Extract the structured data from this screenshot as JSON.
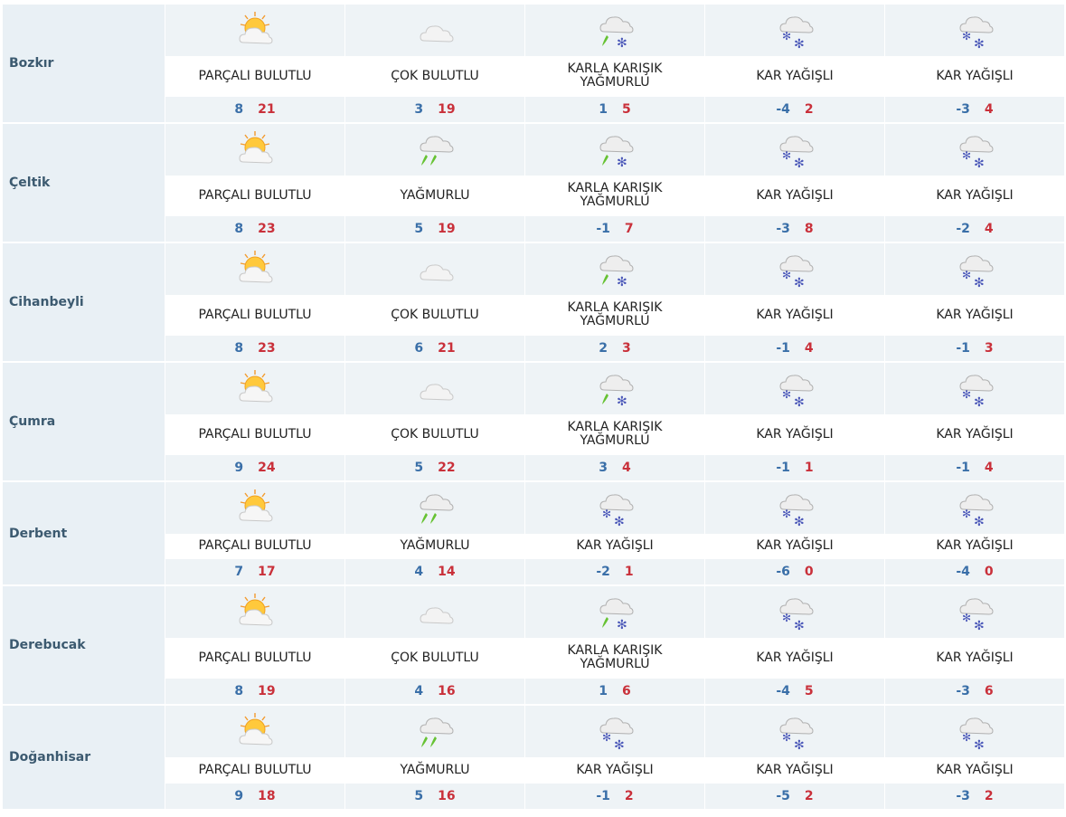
{
  "colors": {
    "min_temp": "#3a6fa8",
    "max_temp": "#c9303a",
    "city": "#3c5a70",
    "band": "#eef3f6"
  },
  "rows": [
    {
      "city": "Bozkır",
      "days": [
        {
          "icon": "partly-cloudy-icon",
          "cond": "PARÇALI BULUTLU",
          "min": "8",
          "max": "21"
        },
        {
          "icon": "cloudy-icon",
          "cond": "ÇOK BULUTLU",
          "min": "3",
          "max": "19"
        },
        {
          "icon": "sleet-icon",
          "cond": "KARLA KARIŞIK YAĞMURLU",
          "min": "1",
          "max": "5"
        },
        {
          "icon": "snow-icon",
          "cond": "KAR YAĞIŞLI",
          "min": "-4",
          "max": "2"
        },
        {
          "icon": "snow-icon",
          "cond": "KAR YAĞIŞLI",
          "min": "-3",
          "max": "4"
        }
      ]
    },
    {
      "city": "Çeltik",
      "days": [
        {
          "icon": "partly-cloudy-icon",
          "cond": "PARÇALI BULUTLU",
          "min": "8",
          "max": "23"
        },
        {
          "icon": "rain-icon",
          "cond": "YAĞMURLU",
          "min": "5",
          "max": "19"
        },
        {
          "icon": "sleet-icon",
          "cond": "KARLA KARIŞIK YAĞMURLU",
          "min": "-1",
          "max": "7"
        },
        {
          "icon": "snow-icon",
          "cond": "KAR YAĞIŞLI",
          "min": "-3",
          "max": "8"
        },
        {
          "icon": "snow-icon",
          "cond": "KAR YAĞIŞLI",
          "min": "-2",
          "max": "4"
        }
      ]
    },
    {
      "city": "Cihanbeyli",
      "days": [
        {
          "icon": "partly-cloudy-icon",
          "cond": "PARÇALI BULUTLU",
          "min": "8",
          "max": "23"
        },
        {
          "icon": "cloudy-icon",
          "cond": "ÇOK BULUTLU",
          "min": "6",
          "max": "21"
        },
        {
          "icon": "sleet-icon",
          "cond": "KARLA KARIŞIK YAĞMURLU",
          "min": "2",
          "max": "3"
        },
        {
          "icon": "snow-icon",
          "cond": "KAR YAĞIŞLI",
          "min": "-1",
          "max": "4"
        },
        {
          "icon": "snow-icon",
          "cond": "KAR YAĞIŞLI",
          "min": "-1",
          "max": "3"
        }
      ]
    },
    {
      "city": "Çumra",
      "days": [
        {
          "icon": "partly-cloudy-icon",
          "cond": "PARÇALI BULUTLU",
          "min": "9",
          "max": "24"
        },
        {
          "icon": "cloudy-icon",
          "cond": "ÇOK BULUTLU",
          "min": "5",
          "max": "22"
        },
        {
          "icon": "sleet-icon",
          "cond": "KARLA KARIŞIK YAĞMURLU",
          "min": "3",
          "max": "4"
        },
        {
          "icon": "snow-icon",
          "cond": "KAR YAĞIŞLI",
          "min": "-1",
          "max": "1"
        },
        {
          "icon": "snow-icon",
          "cond": "KAR YAĞIŞLI",
          "min": "-1",
          "max": "4"
        }
      ]
    },
    {
      "city": "Derbent",
      "days": [
        {
          "icon": "partly-cloudy-icon",
          "cond": "PARÇALI BULUTLU",
          "min": "7",
          "max": "17"
        },
        {
          "icon": "rain-icon",
          "cond": "YAĞMURLU",
          "min": "4",
          "max": "14"
        },
        {
          "icon": "snow-icon",
          "cond": "KAR YAĞIŞLI",
          "min": "-2",
          "max": "1"
        },
        {
          "icon": "snow-icon",
          "cond": "KAR YAĞIŞLI",
          "min": "-6",
          "max": "0"
        },
        {
          "icon": "snow-icon",
          "cond": "KAR YAĞIŞLI",
          "min": "-4",
          "max": "0"
        }
      ]
    },
    {
      "city": "Derebucak",
      "days": [
        {
          "icon": "partly-cloudy-icon",
          "cond": "PARÇALI BULUTLU",
          "min": "8",
          "max": "19"
        },
        {
          "icon": "cloudy-icon",
          "cond": "ÇOK BULUTLU",
          "min": "4",
          "max": "16"
        },
        {
          "icon": "sleet-icon",
          "cond": "KARLA KARIŞIK YAĞMURLU",
          "min": "1",
          "max": "6"
        },
        {
          "icon": "snow-icon",
          "cond": "KAR YAĞIŞLI",
          "min": "-4",
          "max": "5"
        },
        {
          "icon": "snow-icon",
          "cond": "KAR YAĞIŞLI",
          "min": "-3",
          "max": "6"
        }
      ]
    },
    {
      "city": "Doğanhisar",
      "days": [
        {
          "icon": "partly-cloudy-icon",
          "cond": "PARÇALI BULUTLU",
          "min": "9",
          "max": "18"
        },
        {
          "icon": "rain-icon",
          "cond": "YAĞMURLU",
          "min": "5",
          "max": "16"
        },
        {
          "icon": "snow-icon",
          "cond": "KAR YAĞIŞLI",
          "min": "-1",
          "max": "2"
        },
        {
          "icon": "snow-icon",
          "cond": "KAR YAĞIŞLI",
          "min": "-5",
          "max": "2"
        },
        {
          "icon": "snow-icon",
          "cond": "KAR YAĞIŞLI",
          "min": "-3",
          "max": "2"
        }
      ]
    }
  ]
}
